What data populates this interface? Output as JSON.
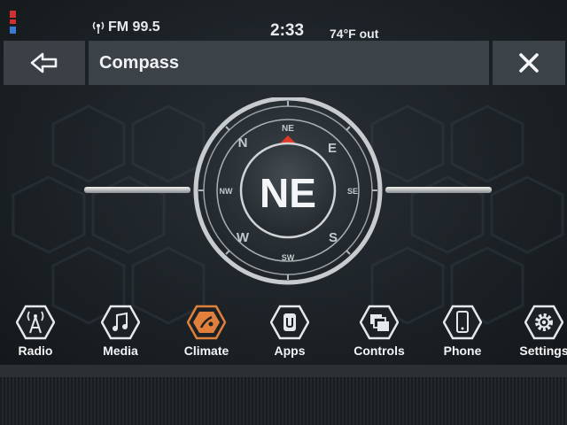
{
  "status": {
    "radio_text": "FM 99.5",
    "time": "2:33",
    "temperature": "74°F out"
  },
  "header": {
    "title": "Compass"
  },
  "compass": {
    "heading": "NE",
    "ring_labels": {
      "north": "N",
      "northeast": "NE",
      "east": "E",
      "southeast": "SE",
      "south": "S",
      "southwest": "SW",
      "west": "W",
      "northwest": "NW"
    }
  },
  "nav": {
    "items": [
      {
        "label": "Radio",
        "icon": "radio-tower-icon"
      },
      {
        "label": "Media",
        "icon": "music-note-icon"
      },
      {
        "label": "Climate",
        "icon": "climate-icon",
        "accent": "#e0803a"
      },
      {
        "label": "Apps",
        "icon": "apps-icon"
      },
      {
        "label": "Controls",
        "icon": "controls-icon"
      },
      {
        "label": "Phone",
        "icon": "phone-icon"
      },
      {
        "label": "Settings",
        "icon": "gear-icon"
      }
    ]
  },
  "colors": {
    "accent": "#e0803a",
    "heading_marker": "#e23a2a",
    "panel": "#3b4248"
  }
}
